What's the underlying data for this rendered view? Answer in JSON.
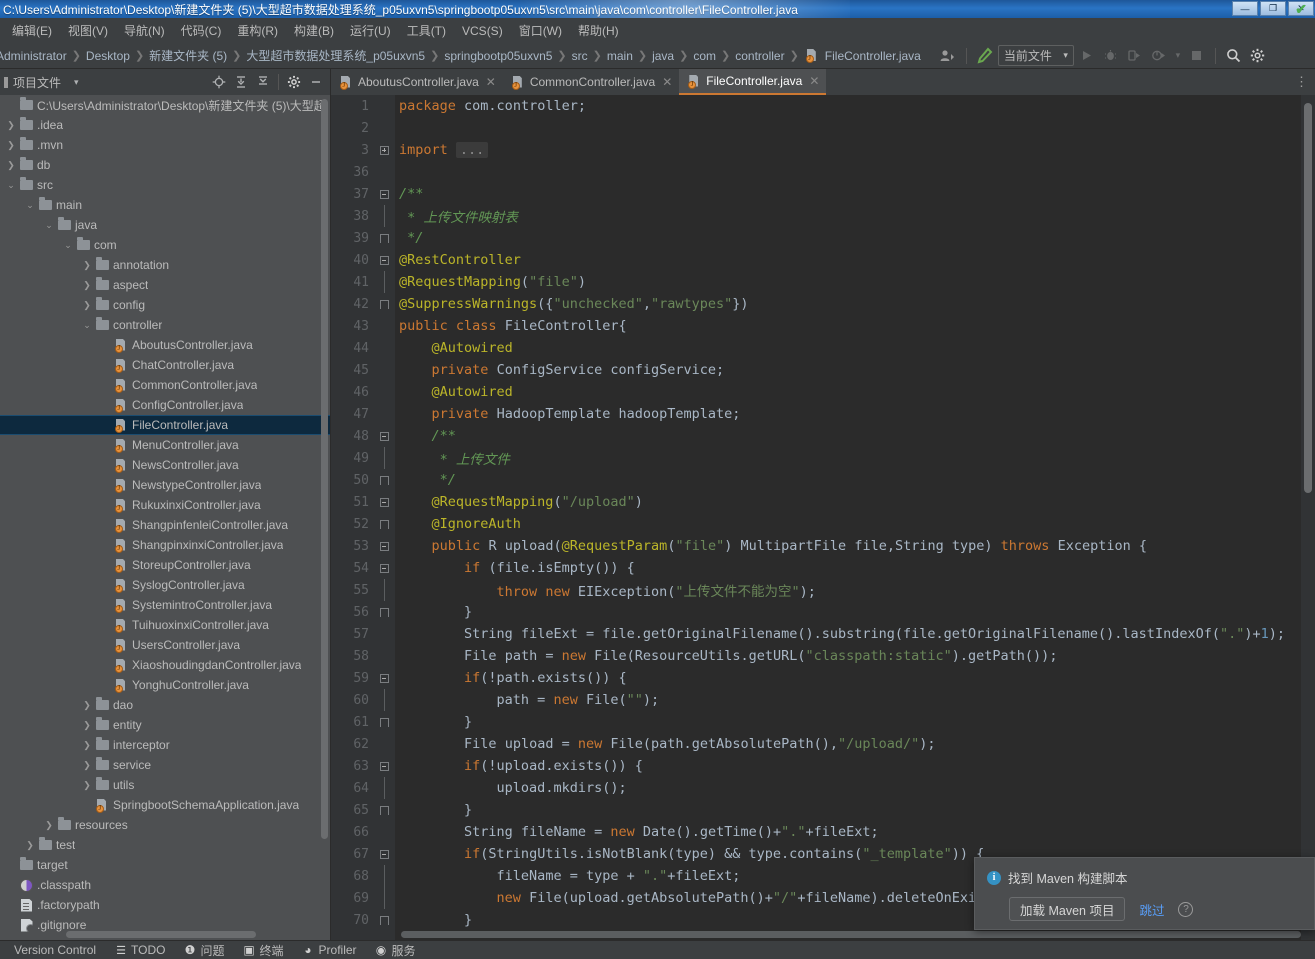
{
  "window": {
    "title": "C:\\Users\\Administrator\\Desktop\\新建文件夹 (5)\\大型超市数据处理系统_p05uxvn5\\springbootp05uxvn5\\src\\main\\java\\com\\controller\\FileController.java",
    "minimize_label": "—",
    "maximize_label": "❐",
    "close_label": "✕",
    "accent_color": "#2a74c4"
  },
  "menubar": {
    "items": [
      "编辑(E)",
      "视图(V)",
      "导航(N)",
      "代码(C)",
      "重构(R)",
      "构建(B)",
      "运行(U)",
      "工具(T)",
      "VCS(S)",
      "窗口(W)",
      "帮助(H)"
    ]
  },
  "navbar": {
    "breadcrumbs": [
      "Administrator",
      "Desktop",
      "新建文件夹 (5)",
      "大型超市数据处理系统_p05uxvn5",
      "springbootp05uxvn5",
      "src",
      "main",
      "java",
      "com",
      "controller"
    ],
    "current_file": "FileController.java",
    "separator": "❯",
    "run_config": "当前文件",
    "run_config_caret": "▾",
    "icons": {
      "profile": "user-profile-icon",
      "build": "build-hammer-icon",
      "run": "run-icon",
      "debug": "debug-icon",
      "coverage": "run-with-coverage-icon",
      "profiler": "profile-icon",
      "stop": "stop-icon",
      "search": "search-everywhere-icon",
      "settings": "settings-gear-icon"
    }
  },
  "project_panel": {
    "title": "项目文件",
    "caret": "▾",
    "toolbar_icons": [
      "locate-icon",
      "expand-all-icon",
      "collapse-all-icon",
      "settings-gear-icon",
      "hide-icon"
    ],
    "tree": [
      {
        "depth": 0,
        "arrow": "",
        "icon": "folder",
        "label": "C:\\Users\\Administrator\\Desktop\\新建文件夹 (5)\\大型超"
      },
      {
        "depth": 0,
        "arrow": "❯",
        "icon": "folder",
        "label": ".idea"
      },
      {
        "depth": 0,
        "arrow": "❯",
        "icon": "folder",
        "label": ".mvn"
      },
      {
        "depth": 0,
        "arrow": "❯",
        "icon": "folder",
        "label": "db"
      },
      {
        "depth": 0,
        "arrow": "⌄",
        "icon": "folder",
        "label": "src"
      },
      {
        "depth": 1,
        "arrow": "⌄",
        "icon": "folder",
        "label": "main"
      },
      {
        "depth": 2,
        "arrow": "⌄",
        "icon": "folder",
        "label": "java"
      },
      {
        "depth": 3,
        "arrow": "⌄",
        "icon": "folder",
        "label": "com"
      },
      {
        "depth": 4,
        "arrow": "❯",
        "icon": "folder",
        "label": "annotation"
      },
      {
        "depth": 4,
        "arrow": "❯",
        "icon": "folder",
        "label": "aspect"
      },
      {
        "depth": 4,
        "arrow": "❯",
        "icon": "folder",
        "label": "config"
      },
      {
        "depth": 4,
        "arrow": "⌄",
        "icon": "folder",
        "label": "controller"
      },
      {
        "depth": 5,
        "arrow": "",
        "icon": "java",
        "label": "AboutusController.java"
      },
      {
        "depth": 5,
        "arrow": "",
        "icon": "java",
        "label": "ChatController.java"
      },
      {
        "depth": 5,
        "arrow": "",
        "icon": "java",
        "label": "CommonController.java"
      },
      {
        "depth": 5,
        "arrow": "",
        "icon": "java",
        "label": "ConfigController.java"
      },
      {
        "depth": 5,
        "arrow": "",
        "icon": "java",
        "label": "FileController.java",
        "selected": true
      },
      {
        "depth": 5,
        "arrow": "",
        "icon": "java",
        "label": "MenuController.java"
      },
      {
        "depth": 5,
        "arrow": "",
        "icon": "java",
        "label": "NewsController.java"
      },
      {
        "depth": 5,
        "arrow": "",
        "icon": "java",
        "label": "NewstypeController.java"
      },
      {
        "depth": 5,
        "arrow": "",
        "icon": "java",
        "label": "RukuxinxiController.java"
      },
      {
        "depth": 5,
        "arrow": "",
        "icon": "java",
        "label": "ShangpinfenleiController.java"
      },
      {
        "depth": 5,
        "arrow": "",
        "icon": "java",
        "label": "ShangpinxinxiController.java"
      },
      {
        "depth": 5,
        "arrow": "",
        "icon": "java",
        "label": "StoreupController.java"
      },
      {
        "depth": 5,
        "arrow": "",
        "icon": "java",
        "label": "SyslogController.java"
      },
      {
        "depth": 5,
        "arrow": "",
        "icon": "java",
        "label": "SystemintroController.java"
      },
      {
        "depth": 5,
        "arrow": "",
        "icon": "java",
        "label": "TuihuoxinxiController.java"
      },
      {
        "depth": 5,
        "arrow": "",
        "icon": "java",
        "label": "UsersController.java"
      },
      {
        "depth": 5,
        "arrow": "",
        "icon": "java",
        "label": "XiaoshoudingdanController.java"
      },
      {
        "depth": 5,
        "arrow": "",
        "icon": "java",
        "label": "YonghuController.java"
      },
      {
        "depth": 4,
        "arrow": "❯",
        "icon": "folder",
        "label": "dao"
      },
      {
        "depth": 4,
        "arrow": "❯",
        "icon": "folder",
        "label": "entity"
      },
      {
        "depth": 4,
        "arrow": "❯",
        "icon": "folder",
        "label": "interceptor"
      },
      {
        "depth": 4,
        "arrow": "❯",
        "icon": "folder",
        "label": "service"
      },
      {
        "depth": 4,
        "arrow": "❯",
        "icon": "folder",
        "label": "utils"
      },
      {
        "depth": 4,
        "arrow": "",
        "icon": "java",
        "label": "SpringbootSchemaApplication.java"
      },
      {
        "depth": 2,
        "arrow": "❯",
        "icon": "folder",
        "label": "resources"
      },
      {
        "depth": 1,
        "arrow": "❯",
        "icon": "folder",
        "label": "test"
      },
      {
        "depth": 0,
        "arrow": "",
        "icon": "folder",
        "label": "target"
      },
      {
        "depth": 0,
        "arrow": "",
        "icon": "dot",
        "label": ".classpath"
      },
      {
        "depth": 0,
        "arrow": "",
        "icon": "doc",
        "label": ".factorypath"
      },
      {
        "depth": 0,
        "arrow": "",
        "icon": "git",
        "label": ".gitignore"
      }
    ]
  },
  "editor": {
    "tabs": [
      {
        "label": "AboutusController.java",
        "active": false,
        "close": "✕"
      },
      {
        "label": "CommonController.java",
        "active": false,
        "close": "✕"
      },
      {
        "label": "FileController.java",
        "active": true,
        "close": "✕"
      }
    ],
    "more_tabs_icon": "⋮",
    "inspection_status": "✔",
    "lines": [
      {
        "n": "1",
        "fold": "",
        "html": "<span class=\"kw\">package</span> <span class=\"plain\">com.controller</span><span class=\"plain\">;</span>"
      },
      {
        "n": "2",
        "fold": "",
        "html": ""
      },
      {
        "n": "3",
        "fold": "plus",
        "html": "<span class=\"kw\">import</span> <span class=\"fold-ph\">...</span>"
      },
      {
        "n": "36",
        "fold": "",
        "html": ""
      },
      {
        "n": "37",
        "fold": "minus-top",
        "html": "<span class=\"cmt\">/**</span>"
      },
      {
        "n": "38",
        "fold": "",
        "html": "<span class=\"cmt\"> * 上传文件映射表</span>"
      },
      {
        "n": "39",
        "fold": "end",
        "html": "<span class=\"cmt\"> */</span>"
      },
      {
        "n": "40",
        "fold": "minus-top",
        "html": "<span class=\"ann\">@RestController</span>"
      },
      {
        "n": "41",
        "fold": "",
        "html": "<span class=\"ann\">@RequestMapping</span><span class=\"plain\">(</span><span class=\"str\">\"file\"</span><span class=\"plain\">)</span>"
      },
      {
        "n": "42",
        "fold": "end",
        "html": "<span class=\"ann\">@SuppressWarnings</span><span class=\"plain\">({</span><span class=\"str\">\"unchecked\"</span><span class=\"plain\">,</span><span class=\"str\">\"rawtypes\"</span><span class=\"plain\">})</span>"
      },
      {
        "n": "43",
        "fold": "",
        "html": "<span class=\"kw\">public</span> <span class=\"kw\">class</span> <span class=\"typ\">FileController</span><span class=\"plain\">{</span>"
      },
      {
        "n": "44",
        "fold": "",
        "html": "    <span class=\"ann\">@Autowired</span>"
      },
      {
        "n": "45",
        "fold": "",
        "html": "    <span class=\"kw\">private</span> <span class=\"typ\">ConfigService</span> <span class=\"typ\">configService</span><span class=\"plain\">;</span>"
      },
      {
        "n": "46",
        "fold": "",
        "html": "    <span class=\"ann\">@Autowired</span>"
      },
      {
        "n": "47",
        "fold": "",
        "html": "    <span class=\"kw\">private</span> <span class=\"typ\">HadoopTemplate</span> <span class=\"typ\">hadoopTemplate</span><span class=\"plain\">;</span>"
      },
      {
        "n": "48",
        "fold": "minus-top",
        "html": "    <span class=\"cmt\">/**</span>"
      },
      {
        "n": "49",
        "fold": "",
        "html": "     <span class=\"cmt\">* 上传文件</span>"
      },
      {
        "n": "50",
        "fold": "end",
        "html": "     <span class=\"cmt\">*/</span>"
      },
      {
        "n": "51",
        "fold": "minus",
        "html": "    <span class=\"ann\">@RequestMapping</span><span class=\"plain\">(</span><span class=\"str\">\"/upload\"</span><span class=\"plain\">)</span>"
      },
      {
        "n": "52",
        "fold": "end",
        "html": "    <span class=\"ann\">@IgnoreAuth</span>"
      },
      {
        "n": "53",
        "fold": "minus",
        "html": "    <span class=\"kw\">public</span> <span class=\"typ\">R</span> <span class=\"typ\">upload</span><span class=\"plain\">(</span><span class=\"ann\">@RequestParam</span><span class=\"plain\">(</span><span class=\"str\">\"file\"</span><span class=\"plain\">) </span><span class=\"typ\">MultipartFile</span> <span class=\"typ\">file</span><span class=\"plain\">,</span><span class=\"typ\">String</span> <span class=\"typ\">type</span><span class=\"plain\">) </span><span class=\"kw\">throws</span> <span class=\"typ\">Exception</span> <span class=\"plain\">{</span>"
      },
      {
        "n": "54",
        "fold": "minus",
        "html": "        <span class=\"kw\">if</span> <span class=\"plain\">(file.isEmpty()) {</span>"
      },
      {
        "n": "55",
        "fold": "",
        "html": "            <span class=\"kw\">throw</span> <span class=\"kw\">new</span> <span class=\"typ\">EIException</span><span class=\"plain\">(</span><span class=\"str\">\"上传文件不能为空\"</span><span class=\"plain\">);</span>"
      },
      {
        "n": "56",
        "fold": "end",
        "html": "        <span class=\"plain\">}</span>"
      },
      {
        "n": "57",
        "fold": "",
        "html": "        <span class=\"typ\">String</span> <span class=\"typ\">fileExt</span> <span class=\"plain\">= file.getOriginalFilename().substring(file.getOriginalFilename().lastIndexOf(</span><span class=\"str\">\".\"</span><span class=\"plain\">)+</span><span class=\"num\">1</span><span class=\"plain\">);</span>"
      },
      {
        "n": "58",
        "fold": "",
        "html": "        <span class=\"typ\">File</span> <span class=\"typ\">path</span> <span class=\"plain\">= </span><span class=\"kw\">new</span> <span class=\"typ\">File</span><span class=\"plain\">(ResourceUtils.getURL(</span><span class=\"str\">\"classpath:static\"</span><span class=\"plain\">).getPath());</span>"
      },
      {
        "n": "59",
        "fold": "minus",
        "html": "        <span class=\"kw\">if</span><span class=\"plain\">(!path.exists()) {</span>"
      },
      {
        "n": "60",
        "fold": "",
        "html": "            <span class=\"plain\">path = </span><span class=\"kw\">new</span> <span class=\"typ\">File</span><span class=\"plain\">(</span><span class=\"str\">\"\"</span><span class=\"plain\">);</span>"
      },
      {
        "n": "61",
        "fold": "end",
        "html": "        <span class=\"plain\">}</span>"
      },
      {
        "n": "62",
        "fold": "",
        "html": "        <span class=\"typ\">File</span> <span class=\"typ\">upload</span> <span class=\"plain\">= </span><span class=\"kw\">new</span> <span class=\"typ\">File</span><span class=\"plain\">(path.getAbsolutePath(),</span><span class=\"str\">\"/upload/\"</span><span class=\"plain\">);</span>"
      },
      {
        "n": "63",
        "fold": "minus",
        "html": "        <span class=\"kw\">if</span><span class=\"plain\">(!upload.exists()) {</span>"
      },
      {
        "n": "64",
        "fold": "",
        "html": "            <span class=\"plain\">upload.mkdirs();</span>"
      },
      {
        "n": "65",
        "fold": "end",
        "html": "        <span class=\"plain\">}</span>"
      },
      {
        "n": "66",
        "fold": "",
        "html": "        <span class=\"typ\">String</span> <span class=\"typ\">fileName</span> <span class=\"plain\">= </span><span class=\"kw\">new</span> <span class=\"typ\">Date</span><span class=\"plain\">().getTime()+</span><span class=\"str\">\".\"</span><span class=\"plain\">+fileExt;</span>"
      },
      {
        "n": "67",
        "fold": "minus",
        "html": "        <span class=\"kw\">if</span><span class=\"plain\">(StringUtils.isNotBlank(type) &amp;&amp; type.contains(</span><span class=\"str\">\"_template\"</span><span class=\"plain\">)) {</span>"
      },
      {
        "n": "68",
        "fold": "",
        "html": "            <span class=\"plain\">fileName = type + </span><span class=\"str\">\".\"</span><span class=\"plain\">+fileExt;</span>"
      },
      {
        "n": "69",
        "fold": "",
        "html": "            <span class=\"kw\">new</span> <span class=\"typ\">File</span><span class=\"plain\">(upload.getAbsolutePath()+</span><span class=\"str\">\"/\"</span><span class=\"plain\">+fileName).deleteOnExit();</span>"
      },
      {
        "n": "70",
        "fold": "end",
        "html": "        <span class=\"plain\">}</span>"
      }
    ]
  },
  "notification": {
    "icon": "info-icon",
    "info_glyph": "i",
    "title": "找到 Maven 构建脚本",
    "primary_button": "加载 Maven 项目",
    "skip_link": "跳过",
    "help_glyph": "?",
    "link_color": "#589df6"
  },
  "statusbar": {
    "items": [
      {
        "label": "Version Control",
        "icon": ""
      },
      {
        "label": "TODO",
        "icon": "list-icon"
      },
      {
        "label": "问题",
        "icon": "warning-icon"
      },
      {
        "label": "终端",
        "icon": "terminal-icon"
      },
      {
        "label": "Profiler",
        "icon": "profiler-icon"
      },
      {
        "label": "服务",
        "icon": "services-icon"
      }
    ]
  }
}
